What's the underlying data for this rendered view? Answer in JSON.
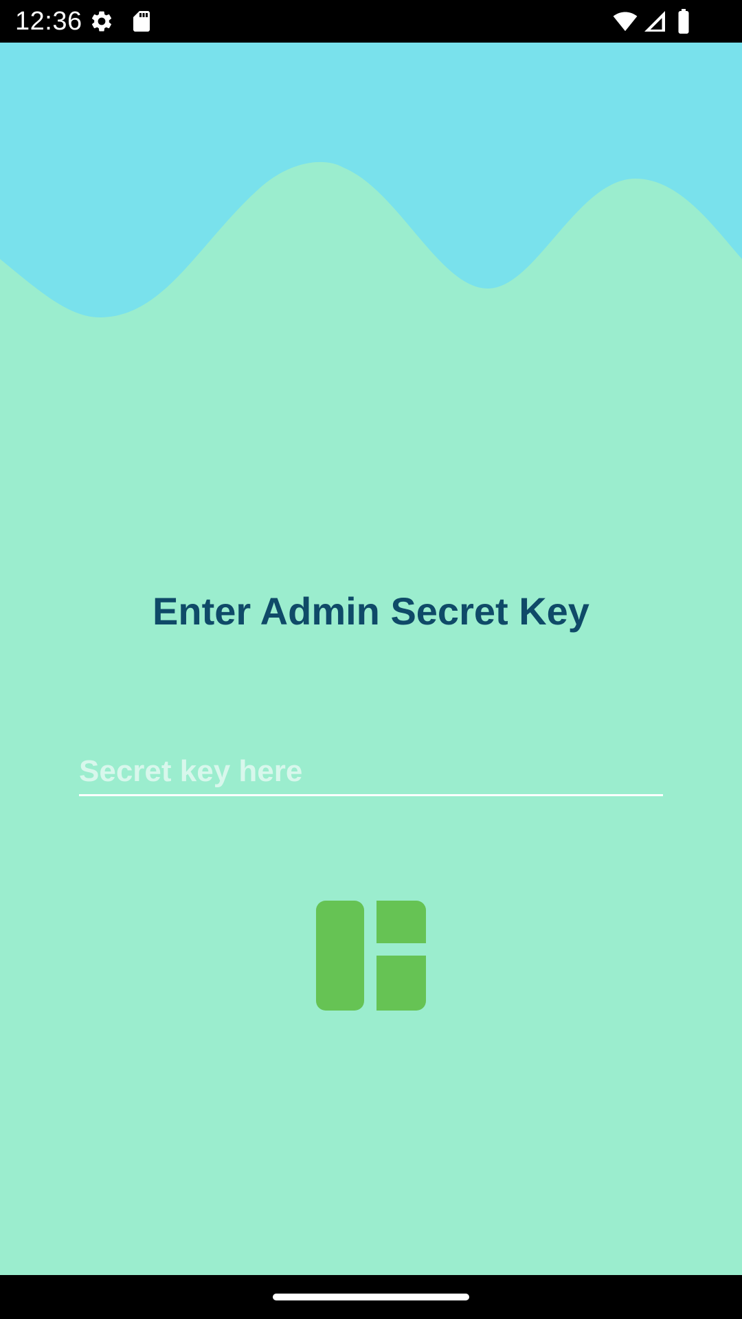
{
  "status_bar": {
    "time": "12:36",
    "icons_left": [
      "gear-icon",
      "sd-card-icon"
    ],
    "icons_right": [
      "wifi-icon",
      "cell-signal-icon",
      "battery-icon"
    ]
  },
  "main": {
    "title": "Enter Admin Secret Key",
    "secret_input": {
      "value": "",
      "placeholder": "Secret key here"
    },
    "logo_icon": "dashboard-layout-icon"
  },
  "colors": {
    "background": "#9bedce",
    "wave_top": "#79e1ec",
    "title": "#0f4a68",
    "logo": "#66c354",
    "bars": "#000000"
  }
}
